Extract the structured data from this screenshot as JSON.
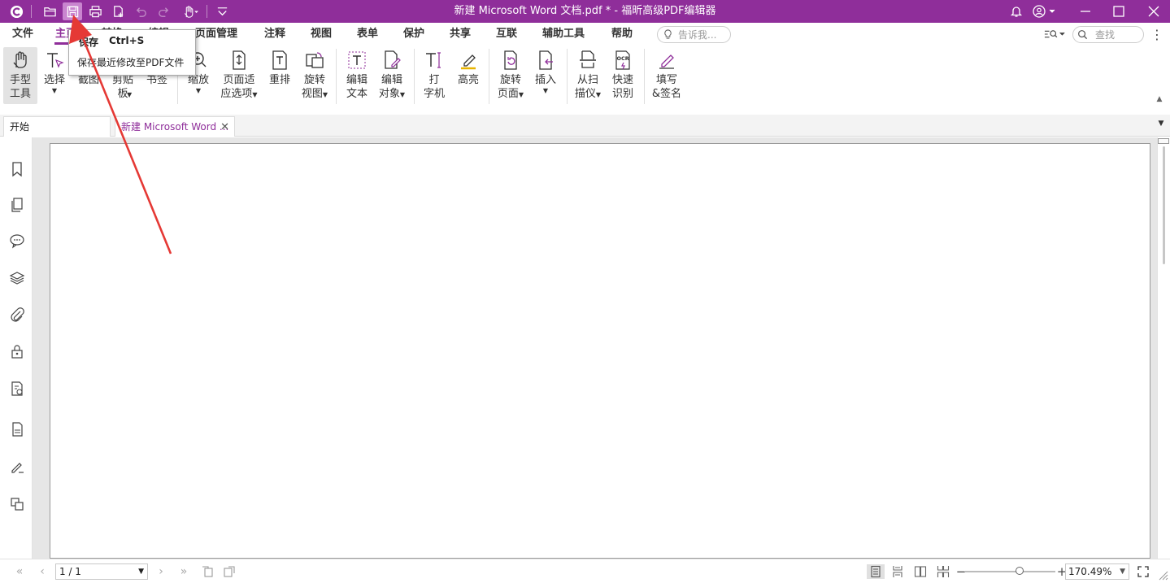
{
  "title_bar": {
    "window_title": "新建 Microsoft Word 文档.pdf * - 福昕高级PDF编辑器",
    "quick_access": [
      "app-logo-icon",
      "open-folder-icon",
      "save-icon",
      "print-icon",
      "new-file-icon",
      "undo-icon",
      "redo-icon",
      "hand-tool-icon",
      "customize-dropdown-icon"
    ],
    "right_controls": [
      "bell-icon",
      "account-icon",
      "minimize-icon",
      "maximize-icon",
      "close-icon"
    ],
    "accent": "#8f2e9a"
  },
  "menu": {
    "items": [
      "文件",
      "主页",
      "转换",
      "编辑",
      "页面管理",
      "注释",
      "视图",
      "表单",
      "保护",
      "共享",
      "互联",
      "辅助工具",
      "帮助"
    ],
    "active": "主页",
    "tell_me_placeholder": "告诉我...",
    "search_placeholder": "查找"
  },
  "ribbon": {
    "hand_tool": [
      "手型",
      "工具"
    ],
    "select": "选择",
    "screenshot": "截图",
    "clipboard": [
      "剪贴",
      "板"
    ],
    "bookmark": "书签",
    "zoom": "缩放",
    "page_fit": [
      "页面适",
      "应选项"
    ],
    "reflow": "重排",
    "rotate_view": [
      "旋转",
      "视图"
    ],
    "edit_text": [
      "编辑",
      "文本"
    ],
    "edit_object": [
      "编辑",
      "对象"
    ],
    "typewriter": [
      "打",
      "字机"
    ],
    "highlight": "高亮",
    "rotate_page": [
      "旋转",
      "页面"
    ],
    "insert": "插入",
    "from_scanner": [
      "从扫",
      "描仪"
    ],
    "quick_ocr": [
      "快速",
      "识别"
    ],
    "fill_sign": [
      "填写",
      "&签名"
    ]
  },
  "tooltip": {
    "title": "保存",
    "shortcut": "Ctrl+S",
    "description": "保存最近修改至PDF文件"
  },
  "tabs": {
    "start": "开始",
    "document": "新建 Microsoft Word ...",
    "close_symbol": "✕"
  },
  "sidebar_icons": [
    "bookmark-icon",
    "pages-icon",
    "comments-icon",
    "layers-icon",
    "attachments-icon",
    "security-icon",
    "signature-check-icon",
    "document-icon",
    "fill-sign-icon",
    "compare-icon"
  ],
  "status_bar": {
    "page_value": "1 / 1",
    "zoom_value": "170.49%",
    "zoom_level": 0.55,
    "view_modes": [
      "single-page-icon",
      "continuous-icon",
      "facing-icon",
      "continuous-facing-icon"
    ],
    "active_view": "single-page-icon"
  }
}
